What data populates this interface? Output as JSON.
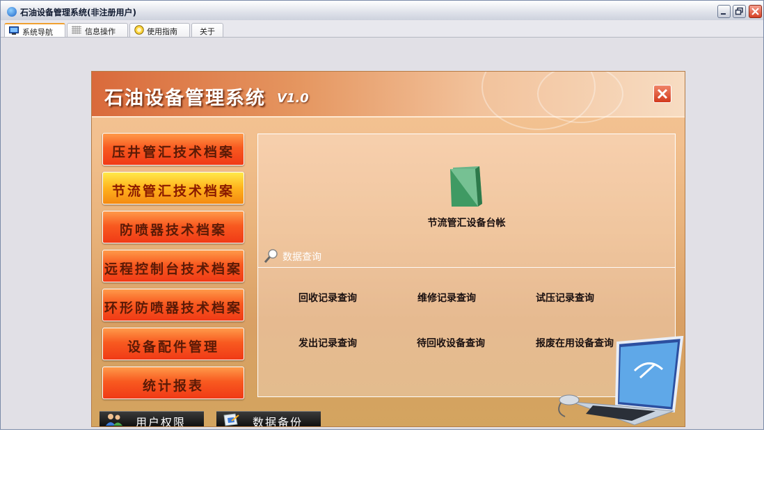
{
  "window": {
    "title": "石油设备管理系统(非注册用户)"
  },
  "tabs": [
    {
      "label": "系统导航",
      "icon": "monitor-icon"
    },
    {
      "label": "信息操作",
      "icon": "grid-icon"
    },
    {
      "label": "使用指南",
      "icon": "help-icon"
    },
    {
      "label": "关于",
      "icon": ""
    }
  ],
  "panel": {
    "title": "石油设备管理系统",
    "version": "V1.0",
    "menu": [
      "压井管汇技术档案",
      "节流管汇技术档案",
      "防喷器技术档案",
      "远程控制台技术档案",
      "环形防喷器技术档案",
      "设备配件管理",
      "统计报表"
    ],
    "selected_menu": "节流管汇技术档案",
    "ledger_label": "节流管汇设备台帐",
    "query_section_label": "数据查询",
    "queries": [
      "回收记录查询",
      "维修记录查询",
      "试压记录查询",
      "发出记录查询",
      "待回收设备查询",
      "报废在用设备查询"
    ],
    "bottom_buttons": [
      "用户权限",
      "数据备份"
    ]
  },
  "colors": {
    "menu_button": "#f85a20",
    "menu_button_selected": "#ffb21c",
    "panel_header": "#e59660",
    "window_bg": "#e1e0e6"
  }
}
